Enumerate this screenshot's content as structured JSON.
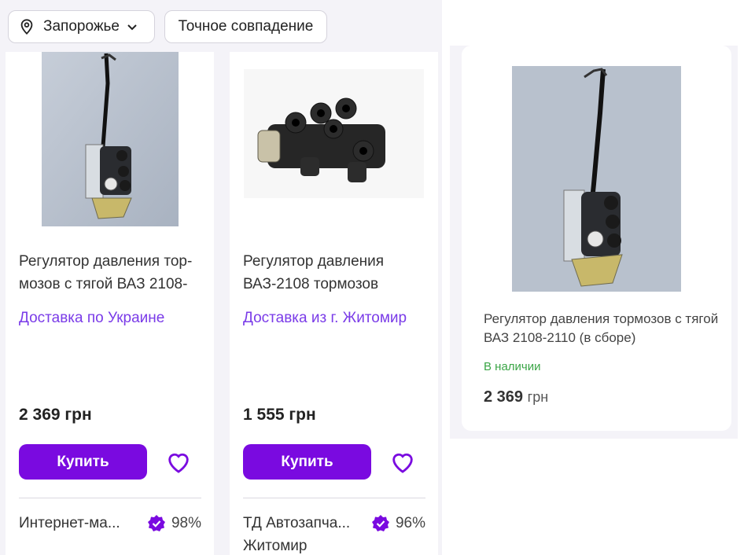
{
  "filters": {
    "location_label": "Запорожье",
    "exact_match_label": "Точное совпадение"
  },
  "cards": [
    {
      "title": "Регулятор давления тор-мозов с тягой ВАЗ 2108-",
      "delivery": "Доставка по Украине",
      "price": "2 369 грн",
      "buy_label": "Купить",
      "seller": "Интернет-ма...",
      "rating": "98%"
    },
    {
      "title": "Регулятор давления ВАЗ-2108 тормозов",
      "delivery": "Доставка из г. Житомир",
      "price": "1 555 грн",
      "buy_label": "Купить",
      "seller": "ТД Автозапча...",
      "seller_city": "Житомир",
      "rating": "96%"
    }
  ],
  "featured": {
    "title": "Регулятор давления тормозов с тягой ВАЗ 2108-2110 (в сборе)",
    "stock": "В наличии",
    "price_value": "2 369",
    "price_currency": "грн"
  },
  "colors": {
    "accent": "#7a0ae0",
    "link": "#7a3be8",
    "in_stock": "#3aa546",
    "page_bg": "#f4f3f8"
  },
  "icons": [
    "location-pin-icon",
    "chevron-down-icon",
    "heart-icon",
    "verified-badge-icon"
  ]
}
